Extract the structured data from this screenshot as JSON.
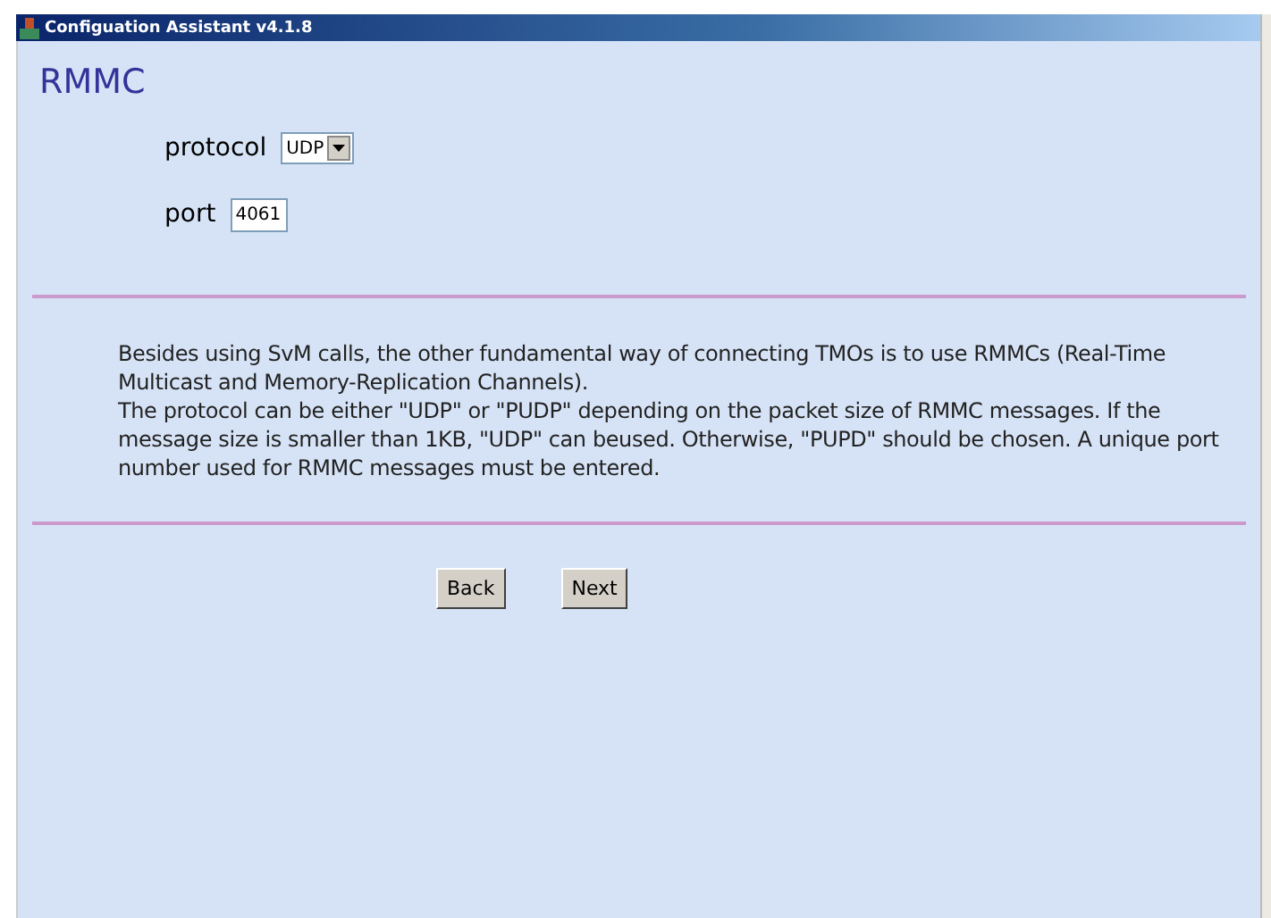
{
  "window": {
    "title": "Configuation Assistant v4.1.8"
  },
  "heading": "RMMC",
  "fields": [
    {
      "kind": "select",
      "label": "protocol",
      "value": "UDP"
    },
    {
      "kind": "text",
      "label": "port",
      "value": "4061"
    }
  ],
  "description": [
    "Besides using SvM calls, the other fundamental way of connecting TMOs is to use RMMCs (Real-Time Multicast and Memory-Replication Channels).",
    "The protocol can be either \"UDP\" or \"PUDP\" depending on the packet size of RMMC messages. If the message size is smaller than 1KB, \"UDP\" can beused. Otherwise, \"PUPD\" should be chosen. A unique port number used for RMMC messages must be entered."
  ],
  "buttons": [
    "Back",
    "Next"
  ]
}
